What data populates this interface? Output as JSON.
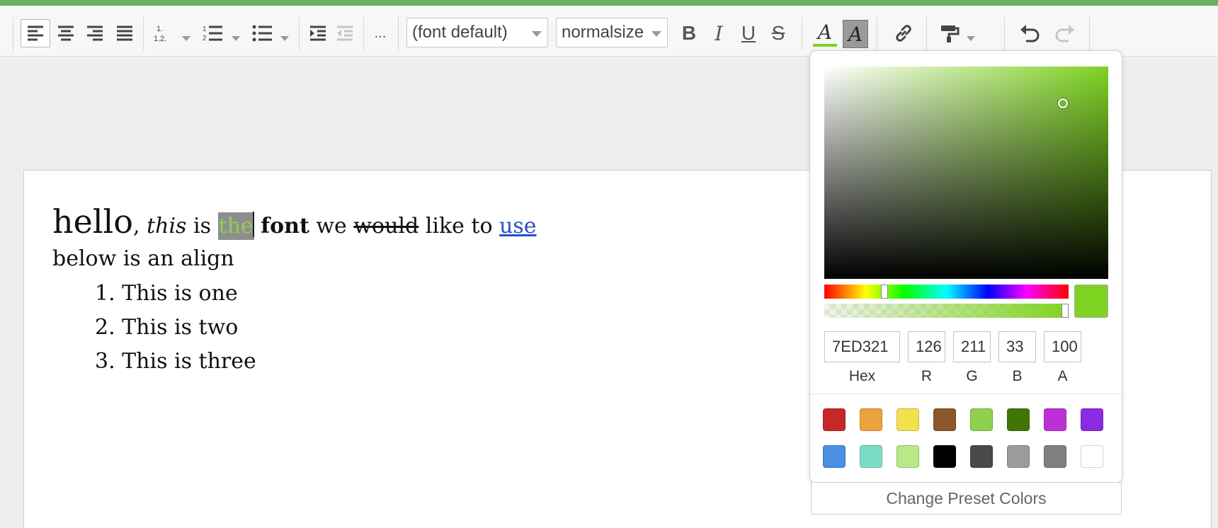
{
  "toolbar": {
    "more_label": "...",
    "font_family": "(font default)",
    "font_size": "normalsize",
    "bold_label": "B",
    "italic_label": "I",
    "underline_label": "U",
    "strike_label": "S",
    "font_color_label": "A",
    "highlight_label": "A",
    "font_color_value": "#7ed321",
    "icons": [
      "align-left",
      "align-center",
      "align-right",
      "align-justify",
      "numbered-list-nested",
      "numbered-list",
      "bullet-list",
      "indent",
      "outdent",
      "link",
      "format-painter",
      "undo",
      "redo"
    ]
  },
  "document": {
    "line1": {
      "hello": "hello",
      "comma": ",",
      "this": "this",
      "is": "is",
      "the": "the",
      "font": "font",
      "we": "we",
      "would": "would",
      "like_to": "like to",
      "use": "use"
    },
    "line2": {
      "text": "below is an",
      "align": "align"
    },
    "list": [
      {
        "num": "1.",
        "text": "This is one"
      },
      {
        "num": "2.",
        "text": "This is two"
      },
      {
        "num": "3.",
        "text": "This is three"
      }
    ]
  },
  "color_picker": {
    "hex": "7ED321",
    "r": "126",
    "g": "211",
    "b": "33",
    "a": "100",
    "labels": {
      "hex": "Hex",
      "r": "R",
      "g": "G",
      "b": "B",
      "a": "A"
    },
    "current_color": "#7ed321",
    "presets": [
      "#c62828",
      "#eba33e",
      "#f4e04d",
      "#8b572a",
      "#8fd14f",
      "#417505",
      "#bd30d6",
      "#8a2be2",
      "#4a90e2",
      "#7ddcc6",
      "#b8e986",
      "#000000",
      "#4a4a4a",
      "#9b9b9b",
      "#808080",
      "#ffffff"
    ],
    "change_preset_label": "Change Preset Colors"
  }
}
